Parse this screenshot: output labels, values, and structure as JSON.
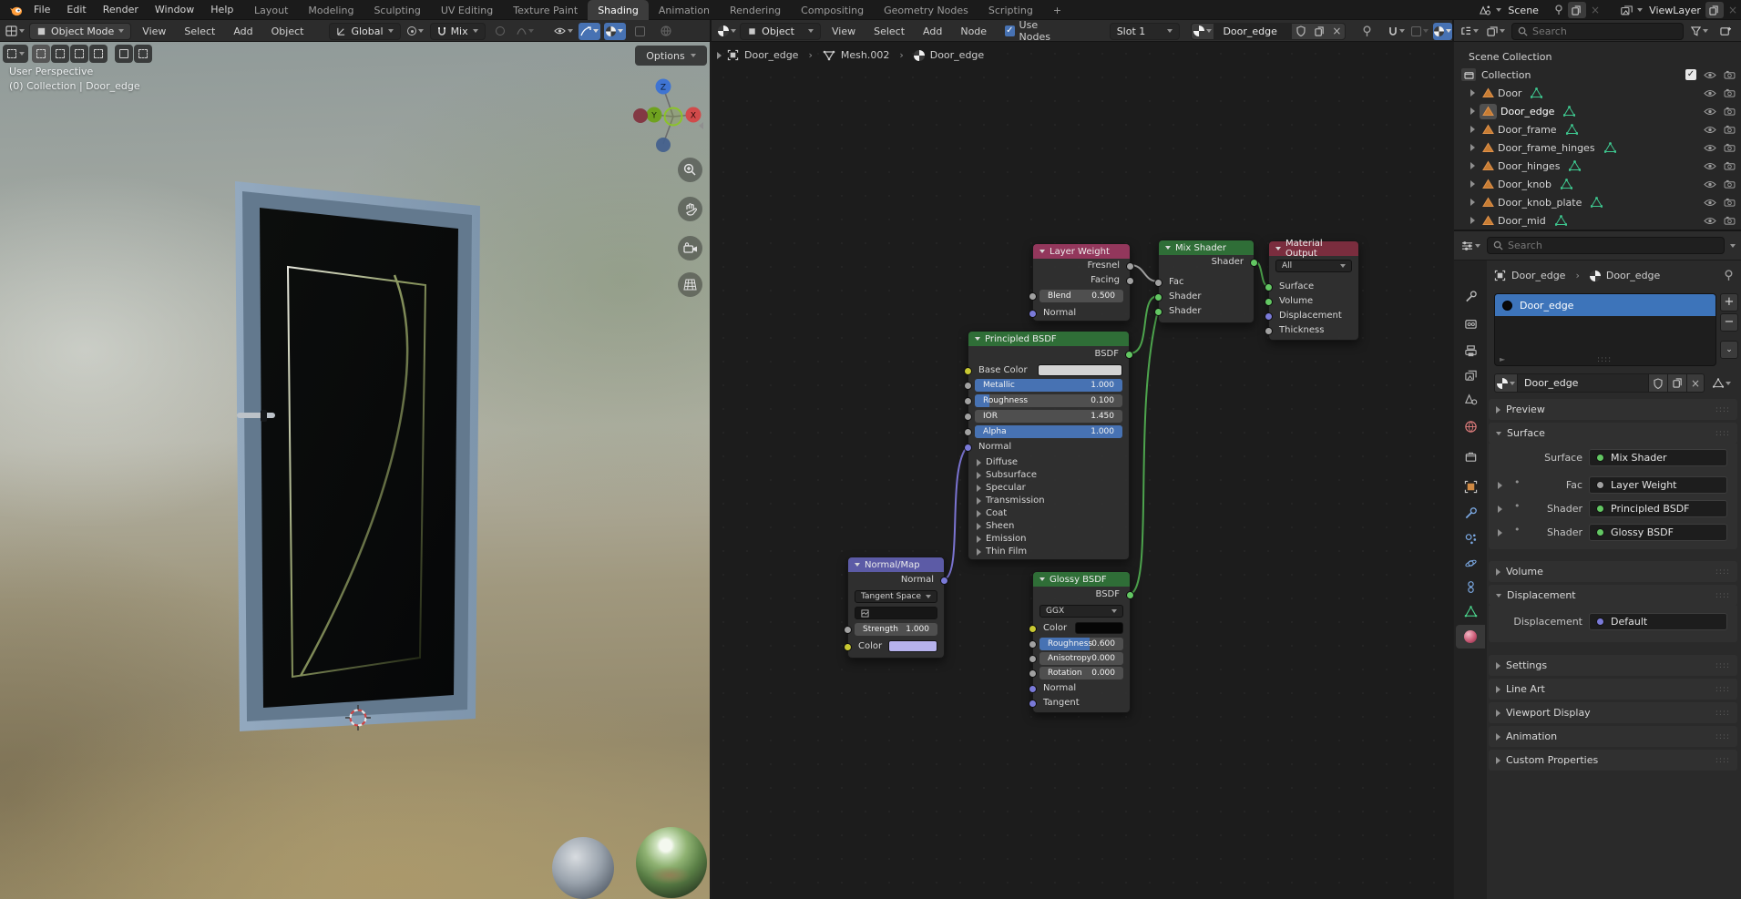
{
  "topbar": {
    "menus": [
      "File",
      "Edit",
      "Render",
      "Window",
      "Help"
    ],
    "tabs": [
      "Layout",
      "Modeling",
      "Sculpting",
      "UV Editing",
      "Texture Paint",
      "Shading",
      "Animation",
      "Rendering",
      "Compositing",
      "Geometry Nodes",
      "Scripting"
    ],
    "plus_tab": "+",
    "scene": "Scene",
    "viewlayer": "ViewLayer"
  },
  "viewport_header": {
    "mode": "Object Mode",
    "menu_view": "View",
    "menu_select": "Select",
    "menu_add": "Add",
    "menu_object": "Object",
    "orientation": "Global",
    "snap_with": "Mix",
    "options": "Options"
  },
  "shader_header": {
    "shader_type": "Object",
    "menu_view": "View",
    "menu_select": "Select",
    "menu_add": "Add",
    "menu_node": "Node",
    "use_nodes": "Use Nodes",
    "slot": "Slot 1",
    "material": "Door_edge"
  },
  "viewport": {
    "view_label": "User Perspective",
    "context_label": "(0) Collection | Door_edge",
    "axis_x": "X",
    "axis_y": "Y",
    "axis_z": "Z"
  },
  "node_editor": {
    "breadcrumb": {
      "object": "Door_edge",
      "mesh": "Mesh.002",
      "material": "Door_edge"
    },
    "layer_weight": {
      "title": "Layer Weight",
      "out_fresnel": "Fresnel",
      "out_facing": "Facing",
      "blend_label": "Blend",
      "blend_value": "0.500",
      "in_normal": "Normal"
    },
    "mix_shader": {
      "title": "Mix Shader",
      "out_shader": "Shader",
      "in_fac": "Fac",
      "in_shader1": "Shader",
      "in_shader2": "Shader"
    },
    "material_output": {
      "title": "Material Output",
      "target": "All",
      "in_surface": "Surface",
      "in_volume": "Volume",
      "in_displacement": "Displacement",
      "in_thickness": "Thickness"
    },
    "principled": {
      "title": "Principled BSDF",
      "out_bsdf": "BSDF",
      "base_color": "Base Color",
      "metallic": "Metallic",
      "metallic_v": "1.000",
      "roughness": "Roughness",
      "roughness_v": "0.100",
      "ior": "IOR",
      "ior_v": "1.450",
      "alpha": "Alpha",
      "alpha_v": "1.000",
      "normal": "Normal",
      "sections": [
        "Diffuse",
        "Subsurface",
        "Specular",
        "Transmission",
        "Coat",
        "Sheen",
        "Emission",
        "Thin Film"
      ]
    },
    "normal_map": {
      "title": "Normal/Map",
      "out_normal": "Normal",
      "space": "Tangent Space",
      "strength": "Strength",
      "strength_v": "1.000",
      "color": "Color"
    },
    "glossy": {
      "title": "Glossy BSDF",
      "out_bsdf": "BSDF",
      "dist": "GGX",
      "color": "Color",
      "roughness": "Roughness",
      "roughness_v": "0.600",
      "anisotropy": "Anisotropy",
      "anisotropy_v": "0.000",
      "rotation": "Rotation",
      "rotation_v": "0.000",
      "in_normal": "Normal",
      "in_tangent": "Tangent"
    }
  },
  "outliner": {
    "search_placeholder": "Search",
    "scene_collection": "Scene Collection",
    "collection": "Collection",
    "items": [
      "Door",
      "Door_edge",
      "Door_frame",
      "Door_frame_hinges",
      "Door_hinges",
      "Door_knob",
      "Door_knob_plate",
      "Door_mid"
    ]
  },
  "properties": {
    "search_placeholder": "Search",
    "crumb_object": "Door_edge",
    "crumb_material": "Door_edge",
    "slot_item": "Door_edge",
    "name_value": "Door_edge",
    "panel_preview": "Preview",
    "panel_surface": "Surface",
    "surface_label": "Surface",
    "surface_value": "Mix Shader",
    "fac_label": "Fac",
    "fac_value": "Layer Weight",
    "shader1_label": "Shader",
    "shader1_value": "Principled BSDF",
    "shader2_label": "Shader",
    "shader2_value": "Glossy BSDF",
    "panel_volume": "Volume",
    "panel_displacement": "Displacement",
    "displacement_label": "Displacement",
    "displacement_value": "Default",
    "panels_collapsed": [
      "Settings",
      "Line Art",
      "Viewport Display",
      "Animation",
      "Custom Properties"
    ]
  },
  "colors": {
    "accent": "#4772b3",
    "node_shader_header": "#2f6e37",
    "node_input_header": "#93375c",
    "node_output_header": "#7a2d3e",
    "node_vector_header": "#5c5ba6",
    "selection_blue": "#3d74ba"
  }
}
